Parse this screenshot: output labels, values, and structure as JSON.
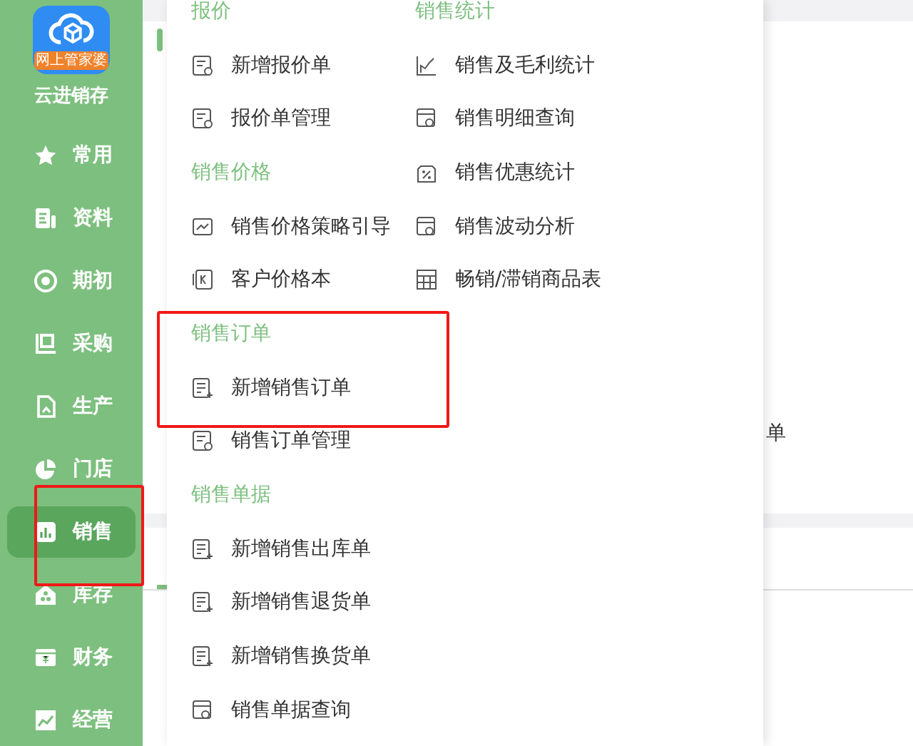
{
  "app": {
    "badge": "网上管家婆",
    "title": "云进销存"
  },
  "sidebar": {
    "items": [
      {
        "label": "常用",
        "selected": false
      },
      {
        "label": "资料",
        "selected": false
      },
      {
        "label": "期初",
        "selected": false
      },
      {
        "label": "采购",
        "selected": false
      },
      {
        "label": "生产",
        "selected": false
      },
      {
        "label": "门店",
        "selected": false
      },
      {
        "label": "销售",
        "selected": true
      },
      {
        "label": "库存",
        "selected": false
      },
      {
        "label": "财务",
        "selected": false
      },
      {
        "label": "经营",
        "selected": false
      }
    ]
  },
  "menu": {
    "columns": [
      {
        "sections": [
          {
            "heading": "报价",
            "items": [
              "新增报价单",
              "报价单管理"
            ]
          },
          {
            "heading": "销售价格",
            "items": [
              "销售价格策略引导",
              "客户价格本"
            ]
          },
          {
            "heading": "销售订单",
            "items": [
              "新增销售订单",
              "销售订单管理"
            ]
          },
          {
            "heading": "销售单据",
            "items": [
              "新增销售出库单",
              "新增销售退货单",
              "新增销售换货单",
              "销售单据查询"
            ]
          }
        ]
      },
      {
        "sections": [
          {
            "heading": "销售统计",
            "items": [
              "销售及毛利统计",
              "销售明细查询",
              "销售优惠统计",
              "销售波动分析",
              "畅销/滞销商品表"
            ]
          }
        ]
      }
    ]
  },
  "background": {
    "fragments": [
      "单"
    ]
  }
}
